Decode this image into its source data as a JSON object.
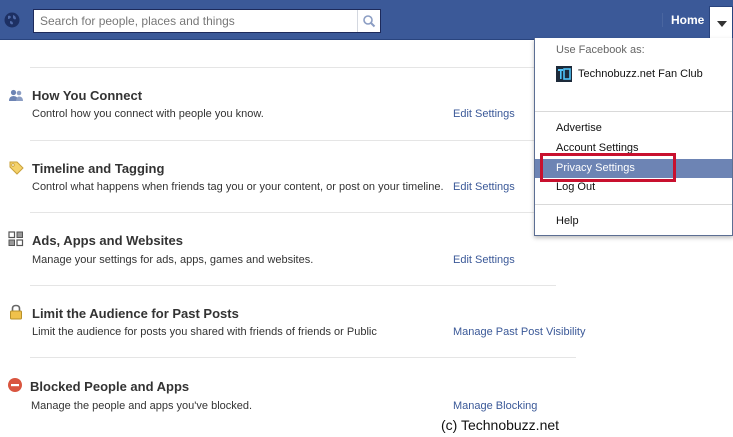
{
  "search": {
    "placeholder": "Search for people, places and things"
  },
  "nav": {
    "home_label": "Home"
  },
  "settings": [
    {
      "title": "How You Connect",
      "description": "Control how you connect with people you know.",
      "link": "Edit Settings",
      "icon": "people-icon"
    },
    {
      "title": "Timeline and Tagging",
      "description": "Control what happens when friends tag you or your content, or post on your timeline.",
      "link": "Edit Settings",
      "icon": "tag-icon"
    },
    {
      "title": "Ads, Apps and Websites",
      "description": "Manage your settings for ads, apps, games and websites.",
      "link": "Edit Settings",
      "icon": "apps-icon"
    },
    {
      "title": "Limit the Audience for Past Posts",
      "description": "Limit the audience for posts you shared with friends of friends or Public",
      "link": "Manage Past Post Visibility",
      "icon": "lock-icon"
    },
    {
      "title": "Blocked People and Apps",
      "description": "Manage the people and apps you've blocked.",
      "link": "Manage Blocking",
      "icon": "blocked-icon"
    }
  ],
  "dropdown": {
    "use_as_label": "Use Facebook as:",
    "page_name": "Technobuzz.net Fan Club",
    "items": [
      "Advertise",
      "Account Settings",
      "Privacy Settings",
      "Log Out",
      "Help"
    ],
    "active_item": "Privacy Settings"
  },
  "credit": "(c) Technobuzz.net",
  "colors": {
    "brand_blue": "#3b5998",
    "link_blue": "#3b5998",
    "highlight_red": "#c8102e",
    "active_item_bg": "#6d84b4"
  }
}
